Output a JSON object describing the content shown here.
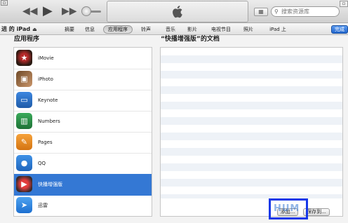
{
  "toolbar": {
    "prev_icon": "rewind-icon",
    "play_icon": "play-icon",
    "next_icon": "fast-forward-icon",
    "logo_icon": "apple-logo-icon",
    "search_placeholder": "搜索资源库"
  },
  "tabbar": {
    "device_label": "进 的 iPad",
    "tabs": [
      "摘要",
      "信息",
      "应用程序",
      "铃声",
      "音乐",
      "影片",
      "电视节目",
      "照片",
      "iPad 上"
    ],
    "active_tab": "应用程序",
    "done_label": "完成"
  },
  "apps_panel": {
    "heading": "应用程序",
    "apps": [
      {
        "name": "iMovie",
        "icon": "imovie-icon"
      },
      {
        "name": "iPhoto",
        "icon": "iphoto-icon"
      },
      {
        "name": "Keynote",
        "icon": "keynote-icon"
      },
      {
        "name": "Numbers",
        "icon": "numbers-icon"
      },
      {
        "name": "Pages",
        "icon": "pages-icon"
      },
      {
        "name": "QQ",
        "icon": "qq-icon"
      },
      {
        "name": "快播增强版",
        "icon": "kuaibo-icon"
      },
      {
        "name": "迅雷",
        "icon": "xunlei-icon"
      }
    ],
    "selected": "快播增强版"
  },
  "docs_panel": {
    "heading": "“快播增强版”的文档",
    "add_label": "添加...",
    "save_label": "保存到..."
  },
  "watermark": "HUM",
  "colors": {
    "selection": "#3478d4",
    "done_button": "#2266cc",
    "annotation": "#1638e8"
  }
}
